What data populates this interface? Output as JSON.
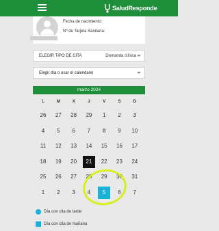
{
  "app": {
    "brand": "SaludResponde"
  },
  "profile": {
    "birth_label": "Fecha de nacimiento:",
    "card_label": "Nº de Tarjeta Sanitaria:"
  },
  "select_type": {
    "label": "ELEGIR TIPO DE CITA",
    "value": "Demanda clínica"
  },
  "select_day": {
    "label": "Elegir día o usar el calendario"
  },
  "calendar": {
    "month": "marzo 2024",
    "weekdays": [
      "L",
      "M",
      "X",
      "J",
      "V",
      "S",
      "D"
    ],
    "weeks": [
      [
        "26",
        "27",
        "28",
        "29",
        "1",
        "2",
        "3"
      ],
      [
        "4",
        "5",
        "6",
        "7",
        "8",
        "9",
        "10"
      ],
      [
        "11",
        "12",
        "13",
        "14",
        "15",
        "16",
        "17"
      ],
      [
        "18",
        "19",
        "20",
        "21",
        "22",
        "23",
        "24"
      ],
      [
        "25",
        "26",
        "27",
        "28",
        "29",
        "30",
        "31"
      ],
      [
        "1",
        "2",
        "3",
        "4",
        "5",
        "6",
        "7"
      ]
    ]
  },
  "legend": {
    "afternoon": "Día con cita de tarde",
    "morning": "Día con cita de mañana"
  },
  "colors": {
    "brand_green": "#1f8e3b",
    "selected_day": "#1ab2d8",
    "today": "#111111",
    "highlight_ring": "#d7ef1a"
  }
}
